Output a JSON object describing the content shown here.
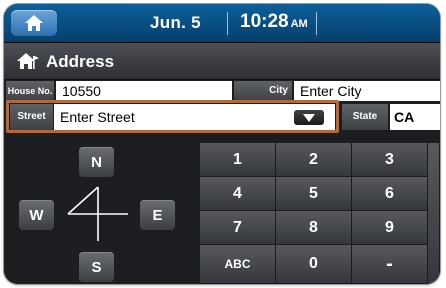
{
  "status_bar": {
    "date": "Jun. 5",
    "time": "10:28",
    "ampm": "AM",
    "home_icon": "home-icon"
  },
  "title_bar": {
    "icon": "house-with-flag-icon",
    "title": "Address"
  },
  "form": {
    "house_no_label": "House No.",
    "house_no_value": "10550",
    "city_label": "City",
    "city_placeholder": "Enter City",
    "street_label": "Street",
    "street_placeholder": "Enter Street",
    "state_label": "State",
    "state_value": "CA",
    "dropdown_icon": "triangle-down-icon"
  },
  "direction_keys": {
    "north": "N",
    "west": "W",
    "east": "E",
    "south": "S",
    "compass_icon": "compass-cross-icon"
  },
  "numpad": {
    "keys": [
      "1",
      "2",
      "3",
      "4",
      "5",
      "6",
      "7",
      "8",
      "9",
      "ABC",
      "0",
      "-"
    ]
  },
  "colors": {
    "status_bar": "#06406c",
    "home_button": "#2d6fb0",
    "street_highlight": "#b26a3c",
    "key": "#4a4d51",
    "background": "#1d1e21"
  }
}
